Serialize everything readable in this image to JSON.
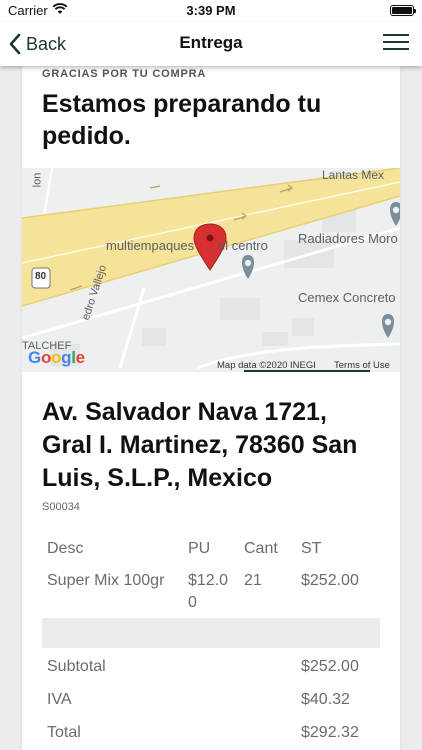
{
  "status_bar": {
    "carrier": "Carrier",
    "time": "3:39 PM"
  },
  "nav": {
    "back_label": "Back",
    "title": "Entrega"
  },
  "header": {
    "eyebrow": "GRACIAS POR TU COMPRA",
    "headline": "Estamos preparando tu pedido."
  },
  "map": {
    "labels": {
      "lantas": "Lantas Mex",
      "multiempaques": "multiempaques",
      "el_centro": "el centro",
      "radiadores": "Radiadores Moro",
      "cemex": "Cemex Concreto",
      "vallejo": "edro Vallejo",
      "talchef": "TALCHEF",
      "road_top": "lon",
      "shield": "80"
    },
    "logo": "Google",
    "attribution": "Map data ©2020 INEGI",
    "terms": "Terms of Use",
    "colors": {
      "highway": "#f6e39a",
      "pin": "#d63031",
      "poi": "#7a8f9c"
    }
  },
  "address": "Av. Salvador Nava 1721, Gral I. Martinez, 78360 San Luis, S.L.P., Mexico",
  "order_code": "S00034",
  "table": {
    "headers": [
      "Desc",
      "PU",
      "Cant",
      "ST"
    ],
    "items": [
      {
        "desc": "Super Mix 100gr",
        "pu": "$12.00",
        "cant": "21",
        "st": "$252.00"
      }
    ],
    "summary": [
      {
        "label": "Subtotal",
        "value": "$252.00"
      },
      {
        "label": "IVA",
        "value": "$40.32"
      },
      {
        "label": "Total",
        "value": "$292.32"
      }
    ]
  }
}
